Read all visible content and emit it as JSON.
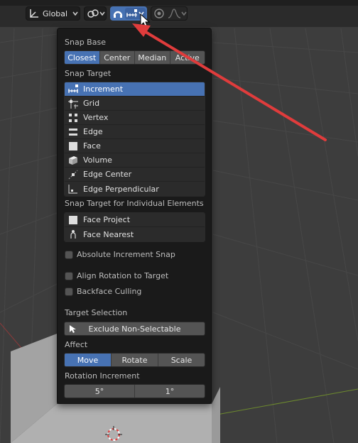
{
  "toolbar": {
    "orientation_label": "Global"
  },
  "popup": {
    "snap_base": {
      "label": "Snap Base",
      "options": [
        "Closest",
        "Center",
        "Median",
        "Active"
      ],
      "selected": "Closest"
    },
    "snap_target": {
      "label": "Snap Target",
      "items": [
        {
          "label": "Increment",
          "icon": "increment-icon",
          "selected": true
        },
        {
          "label": "Grid",
          "icon": "grid-icon"
        },
        {
          "label": "Vertex",
          "icon": "vertex-icon"
        },
        {
          "label": "Edge",
          "icon": "edge-icon"
        },
        {
          "label": "Face",
          "icon": "face-icon"
        },
        {
          "label": "Volume",
          "icon": "volume-icon"
        },
        {
          "label": "Edge Center",
          "icon": "edge-center-icon"
        },
        {
          "label": "Edge Perpendicular",
          "icon": "edge-perpendicular-icon"
        }
      ]
    },
    "individual": {
      "label": "Snap Target for Individual Elements",
      "items": [
        {
          "label": "Face Project",
          "icon": "face-project-icon"
        },
        {
          "label": "Face Nearest",
          "icon": "face-nearest-icon"
        }
      ]
    },
    "checks": {
      "absolute_increment": "Absolute Increment Snap",
      "align_rotation": "Align Rotation to Target",
      "backface_culling": "Backface Culling"
    },
    "target_selection": {
      "label": "Target Selection",
      "button": "Exclude Non-Selectable"
    },
    "affect": {
      "label": "Affect",
      "options": [
        "Move",
        "Rotate",
        "Scale"
      ],
      "selected": "Move"
    },
    "rotation_increment": {
      "label": "Rotation Increment",
      "values": [
        "5°",
        "1°"
      ]
    }
  },
  "colors": {
    "accent": "#4772b3",
    "annotation_arrow": "#e03c3c",
    "popup_bg": "#1a1a1a"
  }
}
